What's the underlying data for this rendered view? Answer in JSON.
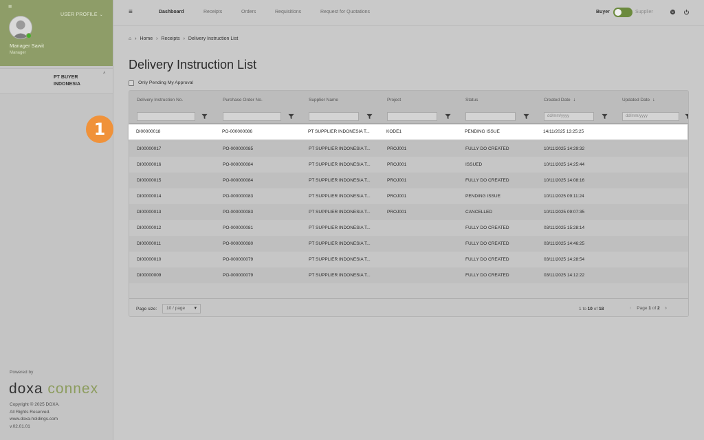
{
  "sidebar": {
    "user_profile_label": "USER PROFILE",
    "user_name": "Manager Sawit",
    "user_role": "Manager",
    "company": "PT BUYER INDONESIA",
    "powered_by": "Powered by",
    "brand_main": "doxa",
    "brand_accent": "connex",
    "copyright": "Copyright © 2025 DOXA.",
    "rights": "All Rights Reserved.",
    "website": "www.doxa-holdings.com",
    "version": "v.02.01.01"
  },
  "topnav": {
    "items": [
      "Dashboard",
      "Receipts",
      "Orders",
      "Requisitions",
      "Request for Quotations"
    ],
    "active": "Dashboard",
    "buyer_label": "Buyer",
    "supplier_label": "Supplier"
  },
  "breadcrumb": [
    "Home",
    "Receipts",
    "Delivery Instruction List"
  ],
  "page_title": "Delivery Instruction List",
  "pending_filter_label": "Only Pending My Approval",
  "table": {
    "columns": [
      "Delivery Instruction No.",
      "Purchase Order No.",
      "Supplier Name",
      "Project",
      "Status",
      "Created Date",
      "Updated Date"
    ],
    "date_placeholder": "dd/mm/yyyy",
    "rows": [
      [
        "DI00000018",
        "PO-000000086",
        "PT SUPPLIER INDONESIA T...",
        "KODE1",
        "PENDING ISSUE",
        "14/11/2025 13:25:25"
      ],
      [
        "DI00000017",
        "PO-000000085",
        "PT SUPPLIER INDONESIA T...",
        "PROJ001",
        "FULLY DO CREATED",
        "10/11/2025 14:29:32"
      ],
      [
        "DI00000016",
        "PO-000000084",
        "PT SUPPLIER INDONESIA T...",
        "PROJ001",
        "ISSUED",
        "10/11/2025 14:25:44"
      ],
      [
        "DI00000015",
        "PO-000000084",
        "PT SUPPLIER INDONESIA T...",
        "PROJ001",
        "FULLY DO CREATED",
        "10/11/2025 14:08:16"
      ],
      [
        "DI00000014",
        "PO-000000083",
        "PT SUPPLIER INDONESIA T...",
        "PROJ001",
        "PENDING ISSUE",
        "10/11/2025 09:11:24"
      ],
      [
        "DI00000013",
        "PO-000000083",
        "PT SUPPLIER INDONESIA T...",
        "PROJ001",
        "CANCELLED",
        "10/11/2025 09:07:35"
      ],
      [
        "DI00000012",
        "PO-000000081",
        "PT SUPPLIER INDONESIA T...",
        "",
        "FULLY DO CREATED",
        "03/11/2025 15:28:14"
      ],
      [
        "DI00000011",
        "PO-000000080",
        "PT SUPPLIER INDONESIA T...",
        "",
        "FULLY DO CREATED",
        "03/11/2025 14:46:25"
      ],
      [
        "DI00000010",
        "PO-000000079",
        "PT SUPPLIER INDONESIA T...",
        "",
        "FULLY DO CREATED",
        "03/11/2025 14:28:54"
      ],
      [
        "DI00000009",
        "PO-000000079",
        "PT SUPPLIER INDONESIA T...",
        "",
        "FULLY DO CREATED",
        "03/11/2025 14:12:22"
      ]
    ]
  },
  "footer": {
    "page_size_label": "Page size:",
    "page_size_value": "10 / page",
    "range_start": "1",
    "range_to": "to",
    "range_end": "10",
    "range_of": "of",
    "total": "18",
    "page_word": "Page",
    "page_current": "1",
    "page_of": "of",
    "page_total": "2"
  },
  "step_badge": "1",
  "colors": {
    "profile_bg": "#8e9d68",
    "toggle_on": "#6b8a3d",
    "step_badge": "#f0923a",
    "brand_accent": "#8c9c5e"
  }
}
